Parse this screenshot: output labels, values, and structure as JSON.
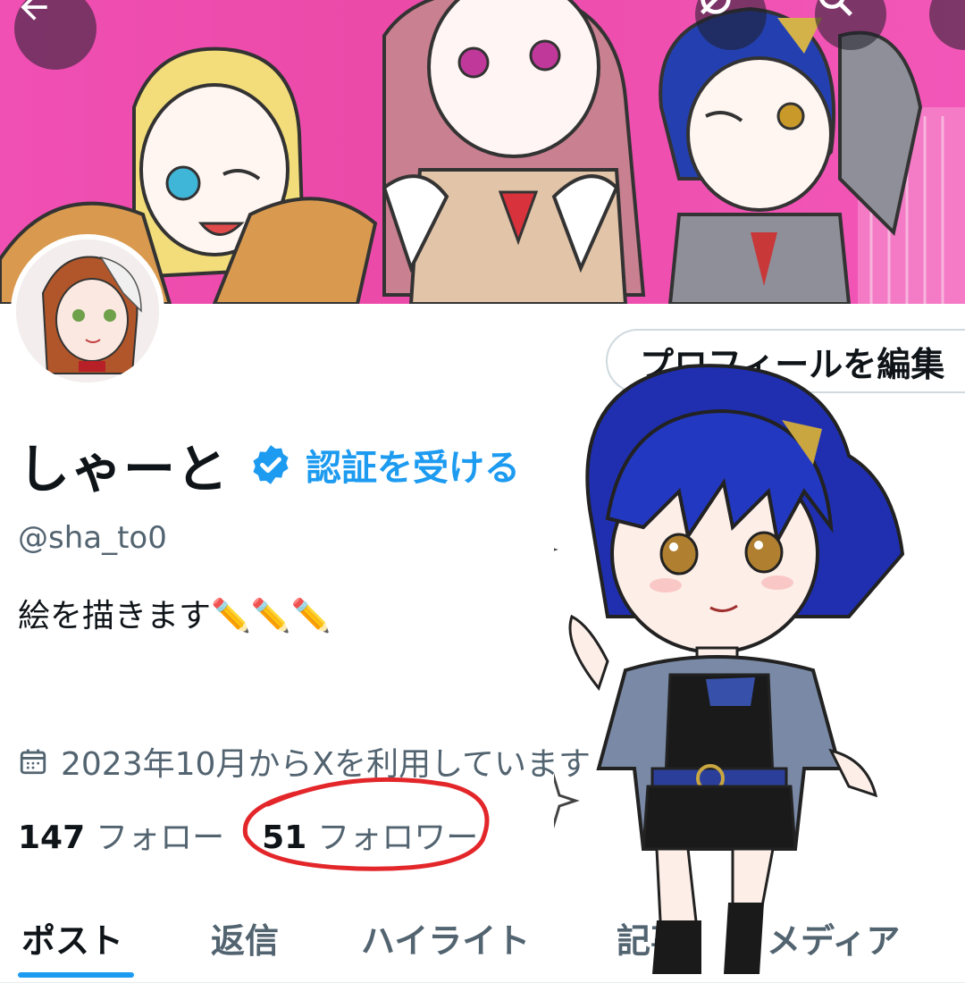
{
  "header": {
    "back_icon": "arrow-left-icon",
    "grok_icon": "grok-slash-circle-icon",
    "search_icon": "search-icon"
  },
  "profile": {
    "edit_button_label": "プロフィールを編集",
    "display_name": "しゃーと",
    "verify_link": "認証を受ける",
    "handle": "@sha_to0",
    "bio": "絵を描きます✏️✏️✏️",
    "joined": "2023年10月からXを利用しています",
    "following_count": "147",
    "following_label": "フォロー",
    "followers_count": "51",
    "followers_label": "フォロワー"
  },
  "tabs": [
    {
      "label": "ポスト",
      "active": true
    },
    {
      "label": "返信",
      "active": false
    },
    {
      "label": "ハイライト",
      "active": false
    },
    {
      "label": "記事",
      "active": false
    },
    {
      "label": "メディア",
      "active": false
    }
  ],
  "colors": {
    "accent": "#1d9bf0",
    "banner_pink": "#ef4fae",
    "annotation_red": "#e3262a",
    "secondary_text": "#536471"
  }
}
